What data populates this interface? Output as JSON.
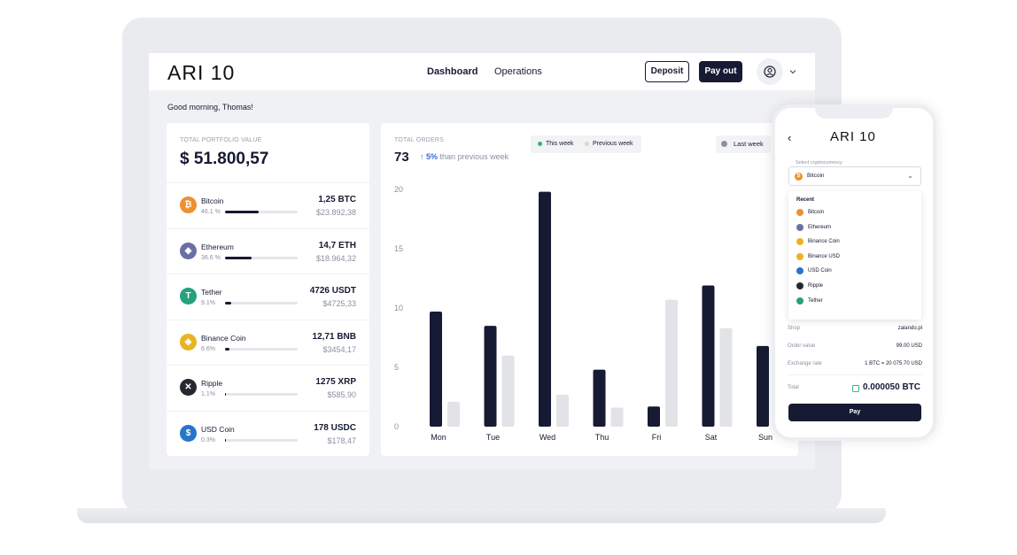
{
  "app": {
    "logo": "ARI 10"
  },
  "header": {
    "nav": [
      {
        "label": "Dashboard",
        "active": true
      },
      {
        "label": "Operations",
        "active": false
      }
    ],
    "deposit_label": "Deposit",
    "payout_label": "Pay out"
  },
  "greeting": "Good morning, Thomas!",
  "portfolio": {
    "label": "TOTAL PORTFOLIO VALUE",
    "value": "$ 51.800,57",
    "assets": [
      {
        "name": "Bitcoin",
        "pct": "46.1 %",
        "share": 0.461,
        "amount": "1,25 BTC",
        "usd": "$23.892,38",
        "color": "#ef8f2f",
        "icon": "bitcoin-icon",
        "glyph": "₿"
      },
      {
        "name": "Ethereum",
        "pct": "36.6 %",
        "share": 0.366,
        "amount": "14,7 ETH",
        "usd": "$18.964,32",
        "color": "#6a6fa5",
        "icon": "ethereum-icon",
        "glyph": "◆"
      },
      {
        "name": "Tether",
        "pct": "9.1%",
        "share": 0.091,
        "amount": "4726 USDT",
        "usd": "$4725,33",
        "color": "#26a17b",
        "icon": "tether-icon",
        "glyph": "T"
      },
      {
        "name": "Binance Coin",
        "pct": "6.6%",
        "share": 0.066,
        "amount": "12,71 BNB",
        "usd": "$3454,17",
        "color": "#e8b422",
        "icon": "binance-icon",
        "glyph": "◈"
      },
      {
        "name": "Ripple",
        "pct": "1.1%",
        "share": 0.011,
        "amount": "1275 XRP",
        "usd": "$585,90",
        "color": "#23292f",
        "icon": "ripple-icon",
        "glyph": "✕"
      },
      {
        "name": "USD Coin",
        "pct": "0.3%",
        "share": 0.003,
        "amount": "178 USDC",
        "usd": "$178,47",
        "color": "#2775ca",
        "icon": "usdcoin-icon",
        "glyph": "$"
      }
    ]
  },
  "orders": {
    "label": "TOTAL ORDERS",
    "value": "73",
    "change_pct": "5%",
    "change_text": "than previous week",
    "legend": {
      "this_week": "This week",
      "previous_week": "Previous week"
    },
    "range_label": "Last week"
  },
  "chart_data": {
    "type": "bar",
    "categories": [
      "Mon",
      "Tue",
      "Wed",
      "Thu",
      "Fri",
      "Sat",
      "Sun"
    ],
    "series": [
      {
        "name": "This week",
        "values": [
          9.7,
          8.5,
          19.8,
          4.8,
          1.7,
          11.9,
          6.8
        ],
        "color": "#161a33"
      },
      {
        "name": "Previous week",
        "values": [
          2.1,
          6.0,
          2.7,
          1.6,
          10.7,
          8.3,
          0
        ],
        "color": "#e1e3e7"
      }
    ],
    "y_ticks": [
      0,
      5,
      10,
      15,
      20
    ],
    "ylim": [
      0,
      20
    ],
    "grid": false,
    "legend_position": "top"
  },
  "phone": {
    "logo": "ARI 10",
    "select_label": "Select cryptocurrency",
    "selected": "Bitcoin",
    "recent_label": "Recent",
    "recent": [
      {
        "name": "Bitcoin",
        "color": "#ef8f2f"
      },
      {
        "name": "Ethereum",
        "color": "#6a6fa5"
      },
      {
        "name": "Binance Coin",
        "color": "#e8b422"
      },
      {
        "name": "Binance USD",
        "color": "#e8b422"
      },
      {
        "name": "USD Coin",
        "color": "#2775ca"
      },
      {
        "name": "Ripple",
        "color": "#23292f"
      },
      {
        "name": "Tether",
        "color": "#26a17b"
      }
    ],
    "shop_label": "Shop",
    "shop_value": "zalando.pl",
    "order_label": "Order value",
    "order_value": "99.00 USD",
    "rate_label": "Exchange rate",
    "rate_value": "1 BTC = 20 075.70 USD",
    "total_label": "Total",
    "total_value": "0.000050 BTC",
    "pay_label": "Pay"
  }
}
